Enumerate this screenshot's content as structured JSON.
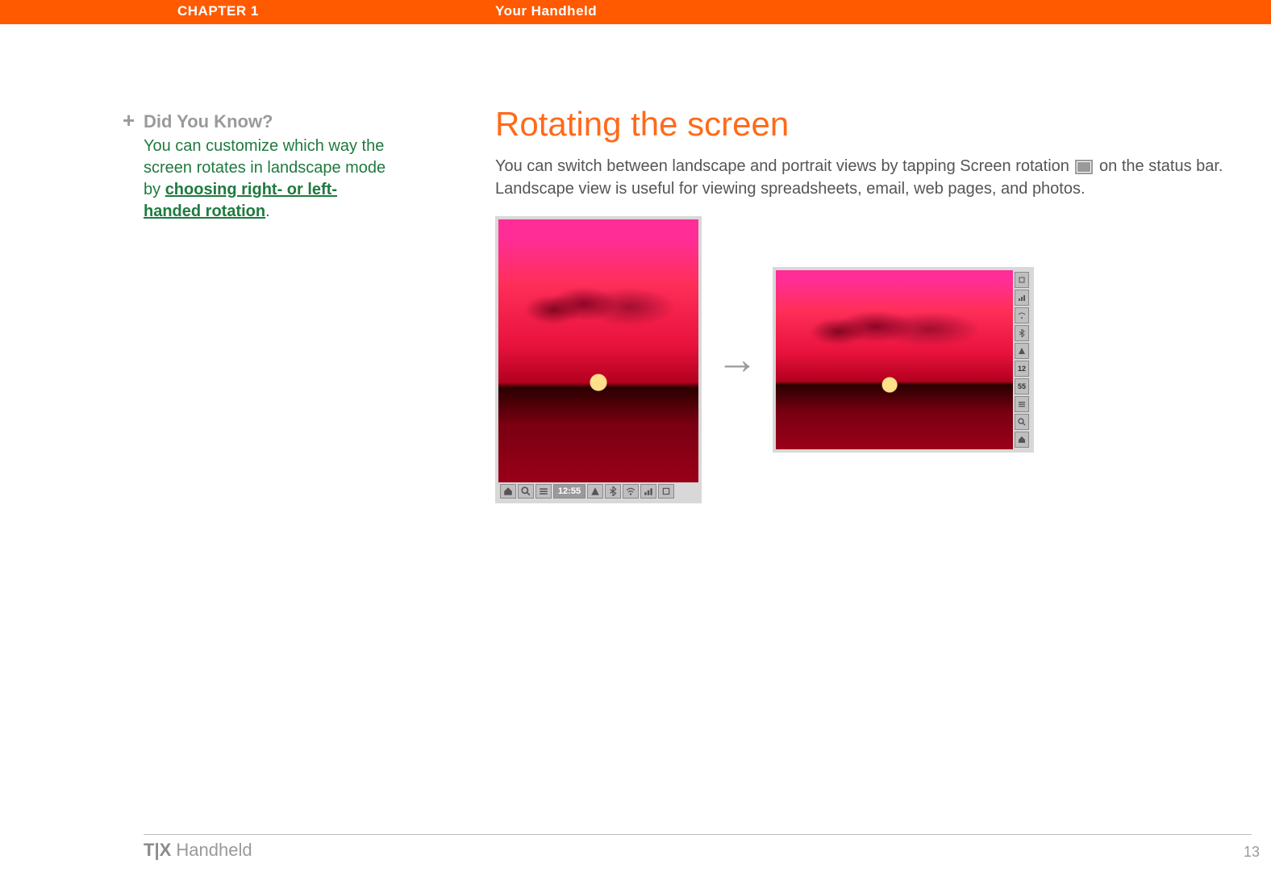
{
  "header": {
    "chapter": "CHAPTER 1",
    "section": "Your Handheld"
  },
  "sidebar": {
    "plus": "+",
    "title": "Did You Know?",
    "body_pre": "You can customize which way the screen rotates in landscape mode by ",
    "link": "choosing right- or left-handed rotation",
    "body_post": "."
  },
  "main": {
    "heading": "Rotating the screen",
    "p1a": "You can switch between landscape and portrait views by tapping Screen rotation ",
    "p1b": " on the status bar. Landscape view is useful for viewing spreadsheets, email, web pages, and photos."
  },
  "portrait_statusbar": {
    "items": [
      "home",
      "find",
      "menu"
    ],
    "time": "12:55",
    "items2": [
      "alert",
      "bt",
      "wifi",
      "signal",
      "rotate"
    ]
  },
  "landscape_statusbar": {
    "items": [
      "rotate",
      "signal",
      "wifi",
      "bt",
      "alert"
    ],
    "time1": "12",
    "time2": "55",
    "items2": [
      "menu",
      "find",
      "home"
    ]
  },
  "arrow": "→",
  "footer": {
    "product_bold": "T|X",
    "product_rest": " Handheld",
    "page": "13"
  }
}
